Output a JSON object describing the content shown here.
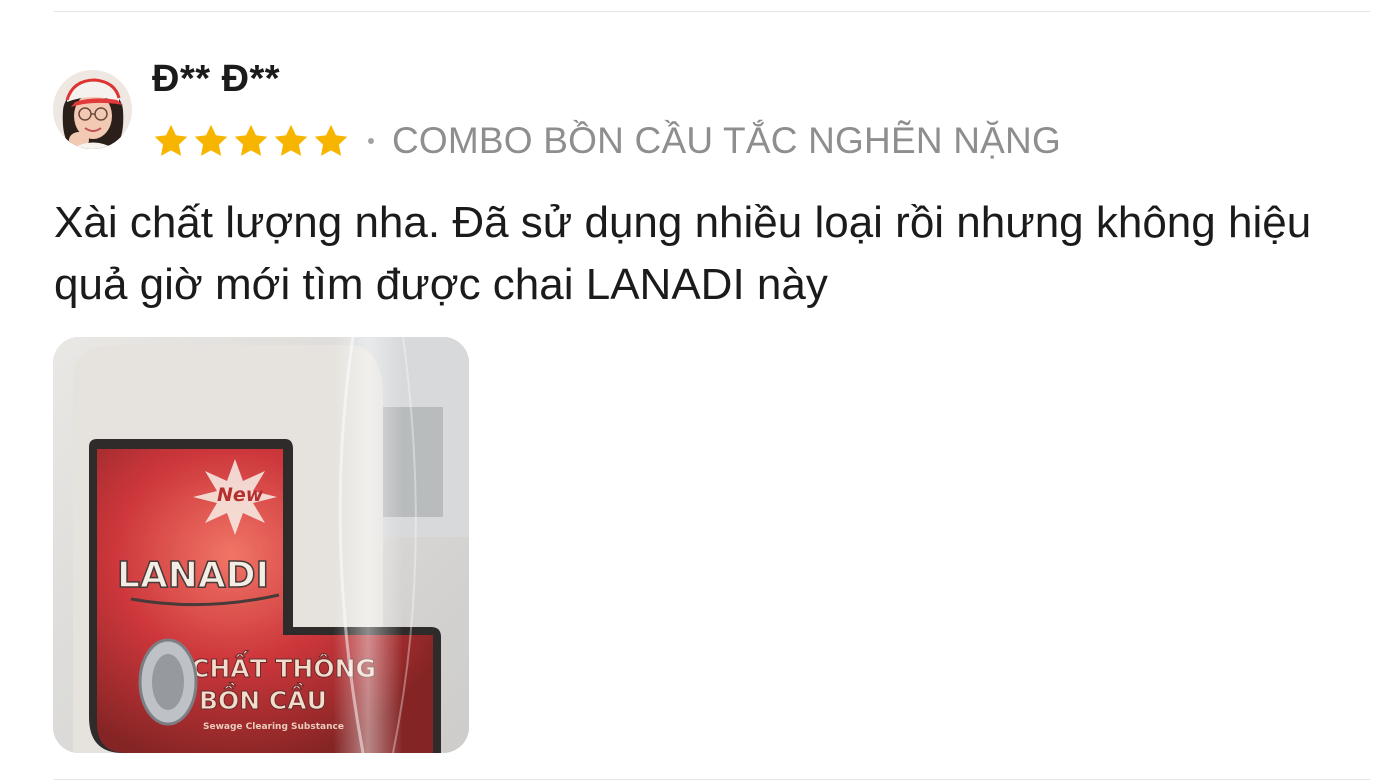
{
  "review": {
    "username": "Đ** Đ**",
    "rating": 5,
    "rating_max": 5,
    "variant": "COMBO BỒN CẦU TẮC NGHẼN NẶNG",
    "text": "Xài chất lượng nha. Đã sử dụng nhiều loại rồi nhưng không hiệu quả giờ mới tìm được chai LANADI này"
  },
  "photo": {
    "badge": "New",
    "brand": "LANADI",
    "product_line1": "CHẤT THÔNG",
    "product_line2": "BỒN CẦU",
    "subtitle": "Sewage Clearing Substance"
  },
  "colors": {
    "star": "#f7b500",
    "label_red": "#c9262b",
    "text": "#1b1b1b",
    "muted": "#8e8e8e"
  }
}
